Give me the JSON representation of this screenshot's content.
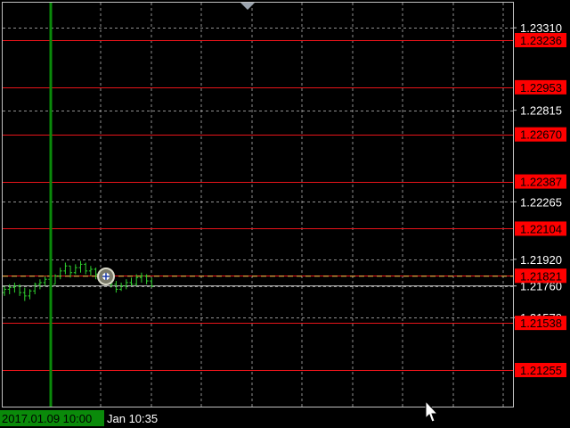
{
  "chart_data": {
    "type": "line",
    "title": "",
    "xlabel": "",
    "ylabel": "",
    "ylim": [
      1.2105,
      1.234
    ],
    "grid": true,
    "y_tick_labels": [
      "1.23310",
      "1.22815",
      "1.22265",
      "1.21920",
      "1.21760",
      "1.21570"
    ],
    "y_ticks": [
      1.2331,
      1.22815,
      1.22265,
      1.2192,
      1.2176,
      1.2157
    ],
    "level_lines": [
      {
        "label": "1.23236",
        "value": 1.23236
      },
      {
        "label": "1.22953",
        "value": 1.22953
      },
      {
        "label": "1.22670",
        "value": 1.2267
      },
      {
        "label": "1.22387",
        "value": 1.22387
      },
      {
        "label": "1.22104",
        "value": 1.22104
      },
      {
        "label": "1.21821",
        "value": 1.21821
      },
      {
        "label": "1.21538",
        "value": 1.21538
      },
      {
        "label": "1.21255",
        "value": 1.21255
      }
    ],
    "current_price": 1.21821,
    "bid_line_value": 1.2176,
    "series": [
      {
        "bars": [
          {
            "h": 1.2176,
            "l": 1.217,
            "o": 1.2172,
            "c": 1.2174
          },
          {
            "h": 1.2177,
            "l": 1.2171,
            "o": 1.2174,
            "c": 1.2175
          },
          {
            "h": 1.2178,
            "l": 1.2172,
            "o": 1.2175,
            "c": 1.2176
          },
          {
            "h": 1.2177,
            "l": 1.217,
            "o": 1.2176,
            "c": 1.2172
          },
          {
            "h": 1.2175,
            "l": 1.2167,
            "o": 1.2172,
            "c": 1.217
          },
          {
            "h": 1.2174,
            "l": 1.2168,
            "o": 1.217,
            "c": 1.2173
          },
          {
            "h": 1.2178,
            "l": 1.2171,
            "o": 1.2173,
            "c": 1.2177
          },
          {
            "h": 1.218,
            "l": 1.2174,
            "o": 1.2177,
            "c": 1.2178
          },
          {
            "h": 1.2182,
            "l": 1.2176,
            "o": 1.2178,
            "c": 1.218
          },
          {
            "h": 1.2181,
            "l": 1.2175,
            "o": 1.218,
            "c": 1.2177
          },
          {
            "h": 1.2183,
            "l": 1.2177,
            "o": 1.2177,
            "c": 1.2182
          },
          {
            "h": 1.2187,
            "l": 1.218,
            "o": 1.2182,
            "c": 1.2185
          },
          {
            "h": 1.219,
            "l": 1.2183,
            "o": 1.2185,
            "c": 1.2188
          },
          {
            "h": 1.2188,
            "l": 1.2181,
            "o": 1.2188,
            "c": 1.2184
          },
          {
            "h": 1.2189,
            "l": 1.2183,
            "o": 1.2184,
            "c": 1.2187
          },
          {
            "h": 1.2191,
            "l": 1.2184,
            "o": 1.2187,
            "c": 1.2189
          },
          {
            "h": 1.219,
            "l": 1.2183,
            "o": 1.2189,
            "c": 1.2185
          },
          {
            "h": 1.2188,
            "l": 1.2182,
            "o": 1.2185,
            "c": 1.2186
          },
          {
            "h": 1.2187,
            "l": 1.218,
            "o": 1.2186,
            "c": 1.2183
          },
          {
            "h": 1.2185,
            "l": 1.2179,
            "o": 1.2183,
            "c": 1.2182
          },
          {
            "h": 1.2184,
            "l": 1.2178,
            "o": 1.2182,
            "c": 1.218
          },
          {
            "h": 1.2182,
            "l": 1.2175,
            "o": 1.218,
            "c": 1.2177
          },
          {
            "h": 1.2179,
            "l": 1.2172,
            "o": 1.2177,
            "c": 1.2174
          },
          {
            "h": 1.2178,
            "l": 1.2173,
            "o": 1.2174,
            "c": 1.2176
          },
          {
            "h": 1.218,
            "l": 1.2174,
            "o": 1.2176,
            "c": 1.2178
          },
          {
            "h": 1.2181,
            "l": 1.2176,
            "o": 1.2178,
            "c": 1.2177
          },
          {
            "h": 1.2183,
            "l": 1.2176,
            "o": 1.2177,
            "c": 1.2181
          },
          {
            "h": 1.2184,
            "l": 1.2178,
            "o": 1.2181,
            "c": 1.2182
          },
          {
            "h": 1.2183,
            "l": 1.2177,
            "o": 1.2182,
            "c": 1.2179
          },
          {
            "h": 1.2181,
            "l": 1.2175,
            "o": 1.2179,
            "c": 1.2176
          }
        ]
      }
    ]
  },
  "time_axis": {
    "cursor_label": "2017.01.09 10:00",
    "tick_label": "Jan 10:35"
  },
  "colors": {
    "background": "#000000",
    "grid": "#c0c0c0",
    "level_line": "#e8141a",
    "level_label_bg": "#ff0000",
    "bar": "#2fd12f",
    "vertical_marker": "#0a8a0a",
    "time_label_bg": "#0a8a0a",
    "bid_line": "#c0c0c0",
    "ask_line": "#e8c84a"
  },
  "icons": {
    "top_marker": "triangle-down-icon",
    "crosshair": "crosshair-target-icon",
    "cursor": "mouse-pointer-icon"
  }
}
